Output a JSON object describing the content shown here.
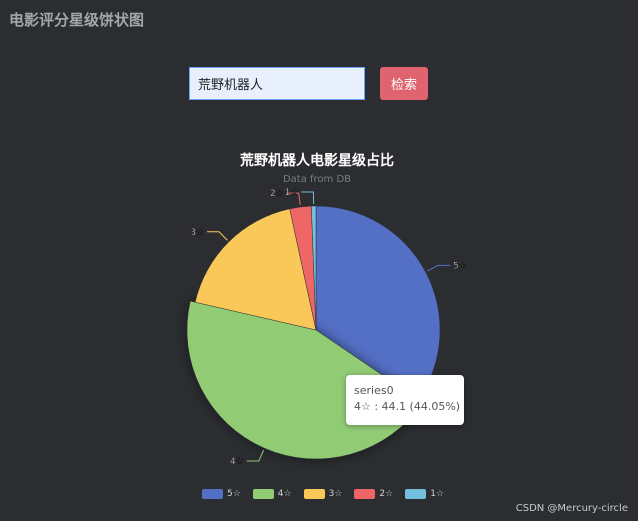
{
  "page": {
    "title": "电影评分星级饼状图",
    "watermark": "CSDN @Mercury-circle"
  },
  "search": {
    "value": "荒野机器人",
    "button_label": "检索"
  },
  "chart_data": {
    "type": "pie",
    "title": "荒野机器人电影星级占比",
    "subtitle": "Data from DB",
    "series_name": "series0",
    "slices": [
      {
        "name": "5☆",
        "value": 34.5,
        "color": "#5470c6"
      },
      {
        "name": "4☆",
        "value": 44.1,
        "color": "#91cc75"
      },
      {
        "name": "3☆",
        "value": 18.0,
        "color": "#fac858"
      },
      {
        "name": "2☆",
        "value": 2.8,
        "color": "#ee6666"
      },
      {
        "name": "1☆",
        "value": 0.6,
        "color": "#73c0de"
      }
    ],
    "legend_position": "bottom",
    "tooltip": {
      "series": "series0",
      "text": "4☆ : 44.1 (44.05%)"
    }
  }
}
